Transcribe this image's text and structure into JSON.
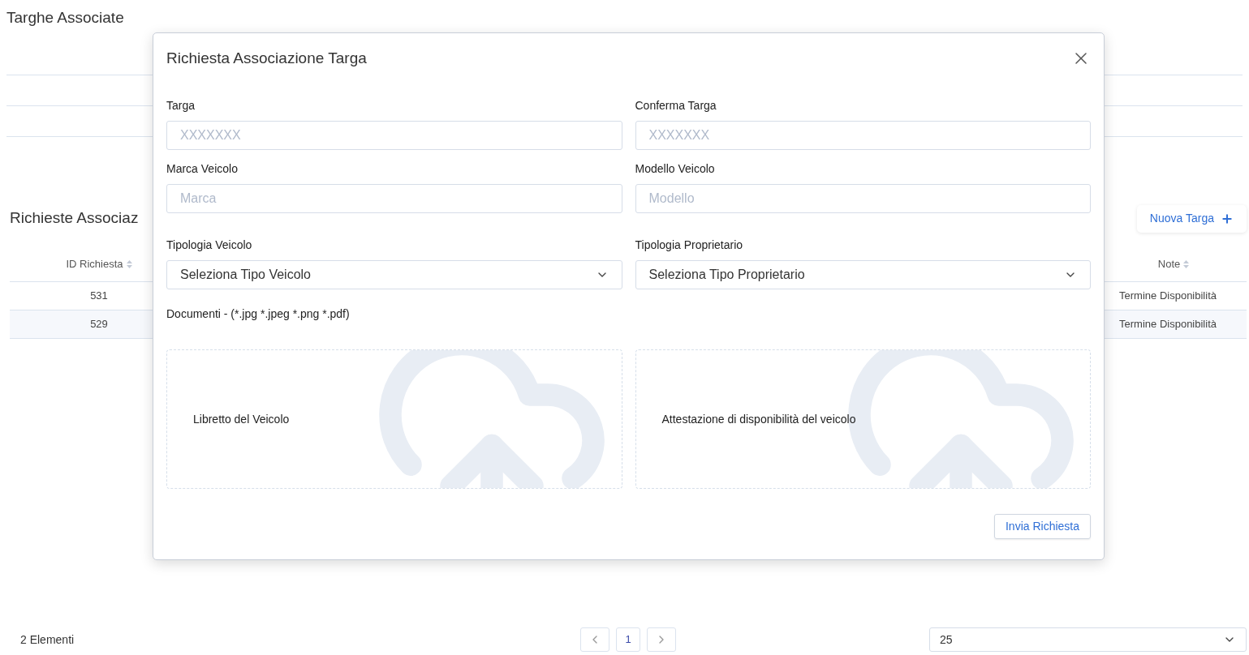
{
  "page": {
    "title": "Targhe Associate"
  },
  "requests": {
    "title": "Richieste Associaz",
    "new_button": "Nuova Targa",
    "columns": [
      {
        "label": "ID Richiesta"
      },
      {
        "label": "Note"
      }
    ],
    "rows": [
      {
        "id": "531",
        "note": "Termine Disponibilità"
      },
      {
        "id": "529",
        "note": "Termine Disponibilità"
      }
    ]
  },
  "footer": {
    "count": "2 Elementi",
    "pages": [
      {
        "label": "1",
        "selected": true
      }
    ],
    "page_size": "25"
  },
  "modal": {
    "title": "Richiesta Associazione Targa",
    "fields": [
      {
        "kind": "input",
        "label": "Targa",
        "placeholder": "XXXXXXX"
      },
      {
        "kind": "input",
        "label": "Conferma Targa",
        "placeholder": "XXXXXXX"
      },
      {
        "kind": "input",
        "label": "Marca Veicolo",
        "placeholder": "Marca"
      },
      {
        "kind": "input",
        "label": "Modello Veicolo",
        "placeholder": "Modello"
      },
      {
        "kind": "select",
        "label": "Tipologia Veicolo",
        "value": "Seleziona Tipo Veicolo"
      },
      {
        "kind": "select",
        "label": "Tipologia Proprietario",
        "value": "Seleziona Tipo Proprietario"
      }
    ],
    "documents_label": "Documenti - (*.jpg *.jpeg *.png *.pdf)",
    "uploads": [
      {
        "label": "Libretto del Veicolo"
      },
      {
        "label": "Attestazione di disponibilità del veicolo"
      }
    ],
    "submit": "Invia Richiesta"
  }
}
